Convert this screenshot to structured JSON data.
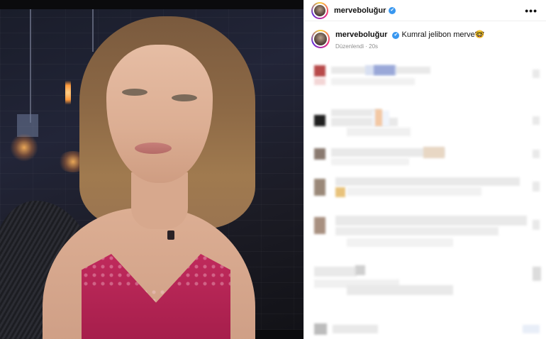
{
  "post": {
    "username": "merveboluğur",
    "verified_icon": "✔",
    "more_label": "•••",
    "caption_user": "merveboluğur",
    "caption_text": "Kumral jelibon merve🤓",
    "edited_label": "Düzenlendi",
    "time_ago": "20s"
  }
}
